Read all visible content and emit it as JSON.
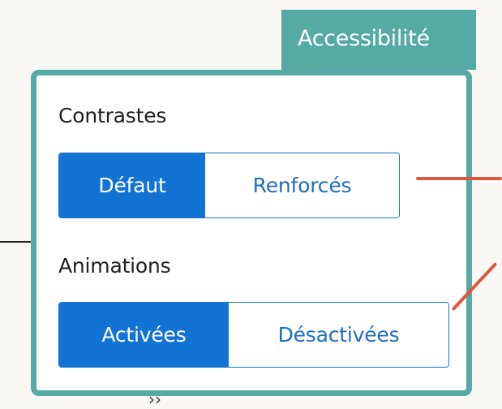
{
  "tab": {
    "label": "Accessibilité"
  },
  "contrast": {
    "label": "Contrastes",
    "options": [
      "Défaut",
      "Renforcés"
    ],
    "selected": "Défaut"
  },
  "animations": {
    "label": "Animations",
    "options": [
      "Activées",
      "Désactivées"
    ],
    "selected": "Activées"
  },
  "colors": {
    "panel_border": "#55aaa4",
    "selected_bg": "#1373d4",
    "option_text": "#1f6dc2",
    "annotation": "#e0563a"
  }
}
